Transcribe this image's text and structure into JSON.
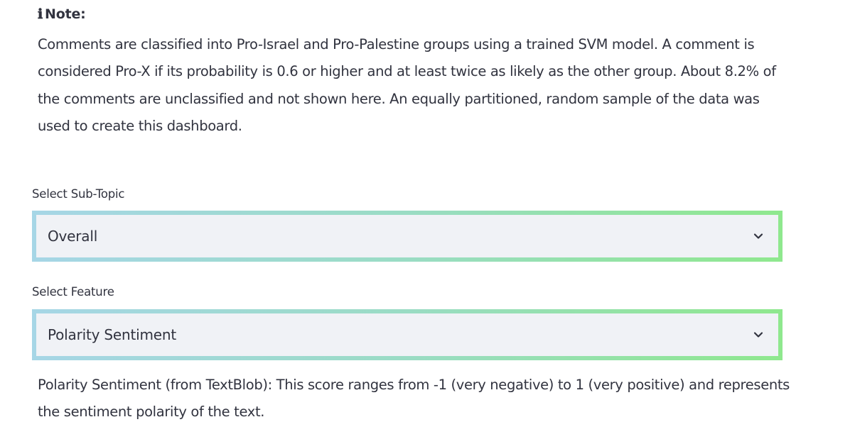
{
  "note": {
    "icon": "information-icon",
    "icon_glyph": "ℹ",
    "title": "Note:",
    "body": "Comments are classified into Pro-Israel and Pro-Palestine groups using a trained SVM model. A comment is considered Pro-X if its probability is 0.6 or higher and at least twice as likely as the other group. About 8.2% of the comments are unclassified and not shown here. An equally partitioned, random sample of the data was used to create this dashboard."
  },
  "subtopic_select": {
    "label": "Select Sub-Topic",
    "value": "Overall",
    "icon": "chevron-down-icon"
  },
  "feature_select": {
    "label": "Select Feature",
    "value": "Polarity Sentiment",
    "icon": "chevron-down-icon"
  },
  "feature_description": "Polarity Sentiment (from TextBlob): This score ranges from -1 (very negative) to 1 (very positive) and represents the sentiment polarity of the text.",
  "colors": {
    "border_gradient_start": "#a6d6e6",
    "border_gradient_end": "#8fe88e",
    "select_background": "#f0f2f6",
    "text": "#31333f"
  }
}
